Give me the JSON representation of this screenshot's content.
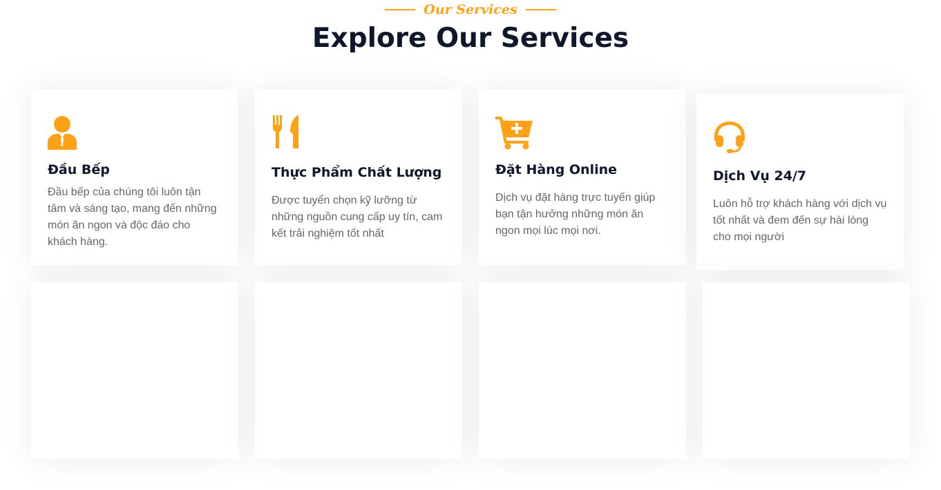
{
  "section": {
    "eyebrow": "Our Services",
    "title": "Explore Our Services"
  },
  "colors": {
    "accent": "#FEA116",
    "heading": "#0F172B",
    "body_text": "#666565"
  },
  "services": [
    {
      "icon": "chef-icon",
      "title": "Đầu Bếp",
      "description": "Đầu bếp của  chúng tôi luôn tận tâm và sáng tạo, mang đến những món ăn ngon và độc đáo cho khách hàng."
    },
    {
      "icon": "utensils-icon",
      "title": "Thực Phẩm Chất Lượng",
      "description": "Được tuyển chọn kỹ lưỡng từ những nguồn cung cấp uy tín, cam kết trải nghiệm tốt nhất"
    },
    {
      "icon": "cart-plus-icon",
      "title": "Đặt Hàng Online",
      "description": "Dịch vụ đặt hàng trực tuyến giúp bạn tận hưởng những món ăn ngon mọi lúc mọi nơi."
    },
    {
      "icon": "headset-icon",
      "title": "Dịch Vụ 24/7",
      "description": "Luôn hỗ trợ khách hàng với dịch vụ tốt nhất và đem đến sự hài lòng cho mọi người"
    }
  ]
}
